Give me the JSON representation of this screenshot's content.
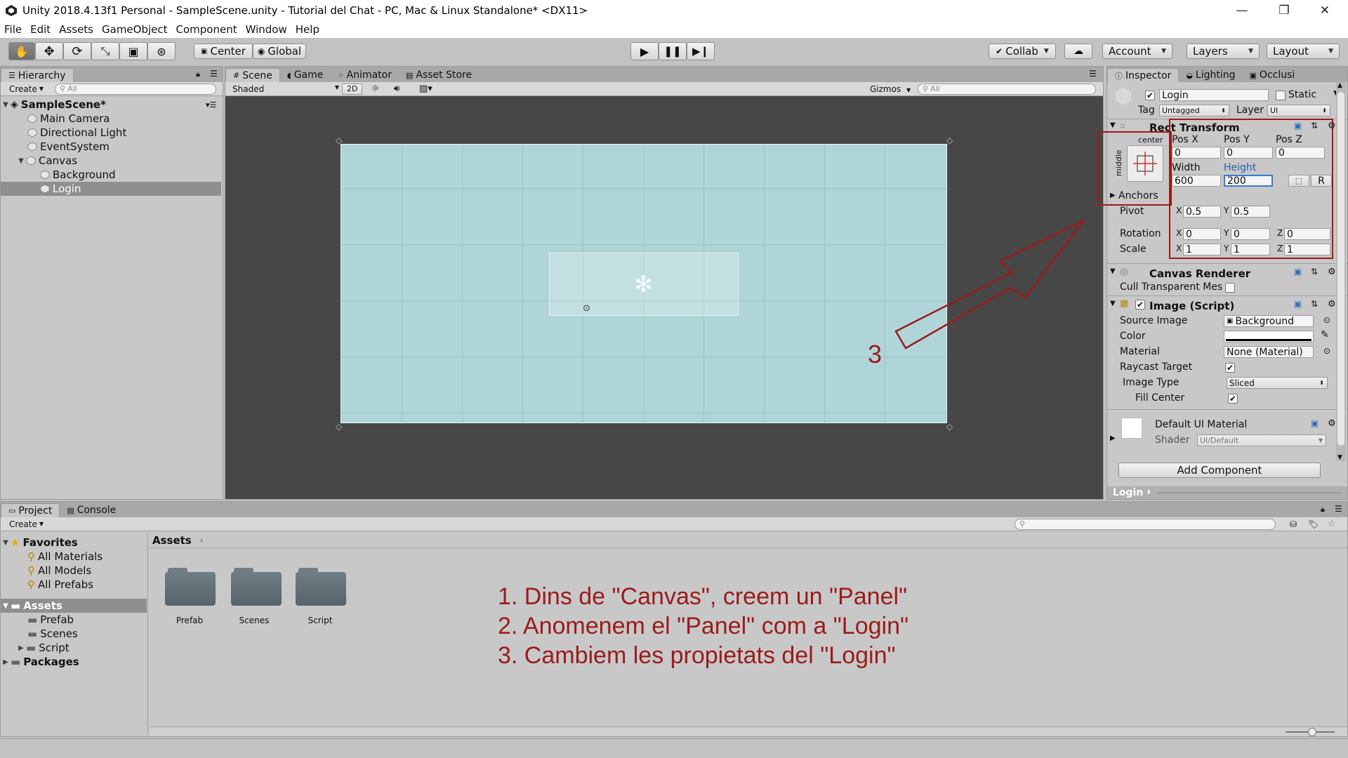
{
  "window": {
    "title": "Unity 2018.4.13f1 Personal - SampleScene.unity - Tutorial del Chat - PC, Mac & Linux Standalone* <DX11>",
    "minimize": "—",
    "maximize": "❐",
    "close": "✕"
  },
  "menu": [
    "File",
    "Edit",
    "Assets",
    "GameObject",
    "Component",
    "Window",
    "Help"
  ],
  "toolbar": {
    "pivot_mode": "Center",
    "pivot_rotation": "Global",
    "collab": "Collab",
    "account": "Account",
    "layers": "Layers",
    "layout": "Layout"
  },
  "hierarchy": {
    "tab": "Hierarchy",
    "create": "Create",
    "search_placeholder": "All",
    "scene": "SampleScene*",
    "items": [
      "Main Camera",
      "Directional Light",
      "EventSystem",
      "Canvas",
      "Background",
      "Login"
    ]
  },
  "scene_tabs": [
    "Scene",
    "Game",
    "Animator",
    "Asset Store"
  ],
  "scene_bar": {
    "shading": "Shaded",
    "mode2d": "2D",
    "gizmos": "Gizmos",
    "search_placeholder": "All"
  },
  "inspector": {
    "tabs": [
      "Inspector",
      "Lighting",
      "Occlusi"
    ],
    "object_name": "Login",
    "static": "Static",
    "tag_label": "Tag",
    "tag": "Untagged",
    "layer_label": "Layer",
    "layer": "UI",
    "rect_transform": "Rect Transform",
    "anchor_h": "center",
    "anchor_v": "middle",
    "pos_x_label": "Pos X",
    "pos_y_label": "Pos Y",
    "pos_z_label": "Pos Z",
    "pos_x": "0",
    "pos_y": "0",
    "pos_z": "0",
    "width_label": "Width",
    "height_label": "Height",
    "width": "600",
    "height": "200",
    "r_button": "R",
    "anchors": "Anchors",
    "pivot_label": "Pivot",
    "pivot_x": "0.5",
    "pivot_y": "0.5",
    "rotation_label": "Rotation",
    "rot_x": "0",
    "rot_y": "0",
    "rot_z": "0",
    "scale_label": "Scale",
    "scale_x": "1",
    "scale_y": "1",
    "scale_z": "1",
    "x": "X",
    "y": "Y",
    "z": "Z",
    "canvas_renderer": "Canvas Renderer",
    "cull": "Cull Transparent Mes",
    "image_script": "Image (Script)",
    "source_image_label": "Source Image",
    "source_image": "Background",
    "color_label": "Color",
    "material_label": "Material",
    "material": "None (Material)",
    "raycast_label": "Raycast Target",
    "image_type_label": "Image Type",
    "image_type": "Sliced",
    "fill_center_label": "Fill Center",
    "default_material": "Default UI Material",
    "shader_label": "Shader",
    "shader": "UI/Default",
    "add_component": "Add Component",
    "footer": "Login"
  },
  "project": {
    "tabs": [
      "Project",
      "Console"
    ],
    "create": "Create",
    "favorites": "Favorites",
    "favorite_items": [
      "All Materials",
      "All Models",
      "All Prefabs"
    ],
    "assets": "Assets",
    "asset_items": [
      "Prefab",
      "Scenes",
      "Script"
    ],
    "packages": "Packages",
    "breadcrumb": "Assets",
    "folders": [
      "Prefab",
      "Scenes",
      "Script"
    ]
  },
  "annotations": {
    "arrow_number": "3",
    "steps": [
      "1. Dins de \"Canvas\", creem un \"Panel\"",
      "2. Anomenem el \"Panel\" com a \"Login\"",
      "3. Cambiem les propietats del \"Login\""
    ]
  },
  "colors": {
    "accent_red": "#9b1b1b",
    "canvas_fill": "#b0d5d8",
    "scene_bg": "#474747",
    "selection": "#8f8f8f"
  }
}
